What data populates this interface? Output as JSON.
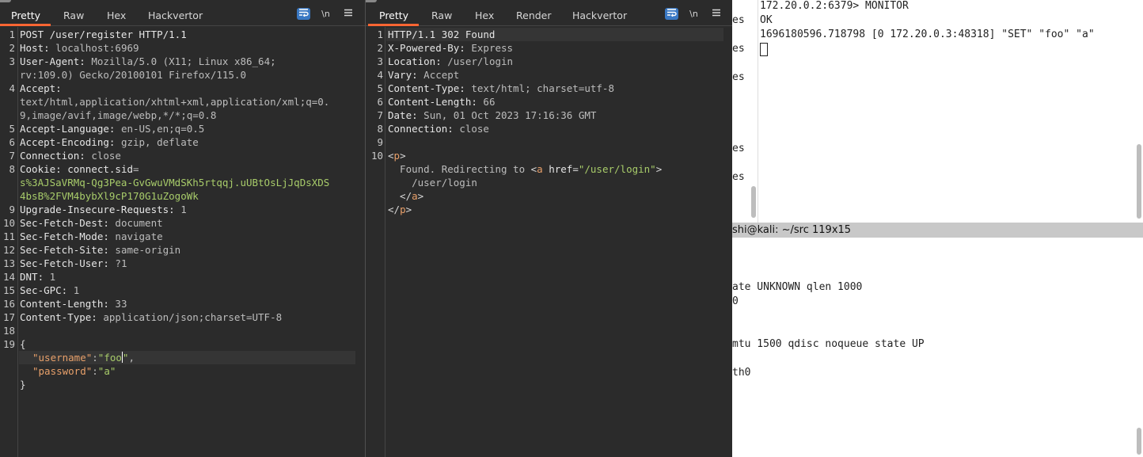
{
  "request_panel": {
    "tabs": [
      {
        "label": "Pretty",
        "active": true
      },
      {
        "label": "Raw",
        "active": false
      },
      {
        "label": "Hex",
        "active": false
      },
      {
        "label": "Hackvertor",
        "active": false
      }
    ],
    "tools": {
      "wrap_icon": "wrap-lines-icon",
      "newline_label": "\\n",
      "menu_icon": "hamburger-menu-icon"
    },
    "line_numbers": [
      "1",
      "2",
      "3",
      "4",
      "5",
      "6",
      "7",
      "8",
      "9",
      "10",
      "11",
      "12",
      "13",
      "14",
      "15",
      "16",
      "17",
      "18",
      "19"
    ],
    "lines": {
      "l1": "POST /user/register HTTP/1.1",
      "l2k": "Host:",
      "l2v": " localhost:6969",
      "l3k": "User-Agent:",
      "l3v": " Mozilla/5.0 (X11; Linux x86_64;",
      "l3c": "rv:109.0) Gecko/20100101 Firefox/115.0",
      "l4k": "Accept:",
      "l4c1": "text/html,application/xhtml+xml,application/xml;q=0.",
      "l4c2": "9,image/avif,image/webp,*/*;q=0.8",
      "l5k": "Accept-Language:",
      "l5v": " en-US,en;q=0.5",
      "l6k": "Accept-Encoding:",
      "l6v": " gzip, deflate",
      "l7k": "Connection:",
      "l7v": " close",
      "l8k": "Cookie:",
      "l8v": " connect.sid",
      "l8eq": "=",
      "l8c1": "s%3AJSaVRMq-Qg3Pea-GvGwuVMdSKh5rtqqj.uUBtOsLjJqDsXDS",
      "l8c2": "4bsB%2FVM4bybXl9cP170G1uZogoWk",
      "l9k": "Upgrade-Insecure-Requests:",
      "l9v": " 1",
      "l10k": "Sec-Fetch-Dest:",
      "l10v": " document",
      "l11k": "Sec-Fetch-Mode:",
      "l11v": " navigate",
      "l12k": "Sec-Fetch-Site:",
      "l12v": " same-origin",
      "l13k": "Sec-Fetch-User:",
      "l13v": " ?1",
      "l14k": "DNT:",
      "l14v": " 1",
      "l15k": "Sec-GPC:",
      "l15v": " 1",
      "l16k": "Content-Length:",
      "l16v": " 33",
      "l17k": "Content-Type:",
      "l17v": " application/json;charset=UTF-8",
      "l19": "{",
      "l20key": "\"username\"",
      "l20colon": ":",
      "l20val": "\"foo",
      "l20val2": "\"",
      "l20comma": ",",
      "l21key": "\"password\"",
      "l21colon": ":",
      "l21val": "\"a\"",
      "l22": "}"
    }
  },
  "response_panel": {
    "tabs": [
      {
        "label": "Pretty",
        "active": true
      },
      {
        "label": "Raw",
        "active": false
      },
      {
        "label": "Hex",
        "active": false
      },
      {
        "label": "Render",
        "active": false
      },
      {
        "label": "Hackvertor",
        "active": false
      }
    ],
    "tools": {
      "wrap_icon": "wrap-lines-icon",
      "newline_label": "\\n",
      "menu_icon": "hamburger-menu-icon"
    },
    "line_numbers": [
      "1",
      "2",
      "3",
      "4",
      "5",
      "6",
      "7",
      "8",
      "9",
      "10"
    ],
    "lines": {
      "l1": "HTTP/1.1 302 Found",
      "l2k": "X-Powered-By:",
      "l2v": " Express",
      "l3k": "Location:",
      "l3v": " /user/login",
      "l4k": "Vary:",
      "l4v": " Accept",
      "l5k": "Content-Type:",
      "l5v": " text/html; charset=utf-8",
      "l6k": "Content-Length:",
      "l6v": " 66",
      "l7k": "Date:",
      "l7v": " Sun, 01 Oct 2023 17:16:36 GMT",
      "l8k": "Connection:",
      "l8v": " close",
      "l10a": "<",
      "l10tag": "p",
      "l10b": ">",
      "l11text": "  Found. Redirecting to ",
      "l11lt": "<",
      "l11tag": "a",
      "l11attr": " href",
      "l11eq": "=",
      "l11val": "\"/user/login\"",
      "l11gt": ">",
      "l12": "    /user/login",
      "l13a": "  </",
      "l13tag": "a",
      "l13b": ">",
      "l14a": "</",
      "l14tag": "p",
      "l14b": ">"
    }
  },
  "terminal": {
    "top_lines": [
      "172.20.0.2:6379> MONITOR",
      "OK",
      "1696180596.718798 [0 172.20.0.3:48318] \"SET\" \"foo\" \"a\""
    ],
    "left_fragments": [
      "es",
      "es",
      "es",
      "es",
      "es"
    ],
    "title": "shi@kali: ~/src 119x15",
    "bottom_lines": [
      "ate UNKNOWN qlen 1000",
      "0",
      "mtu 1500 qdisc noqueue state UP",
      "th0"
    ]
  },
  "colors": {
    "accent_tab": "#ff6633",
    "wrap_button": "#3a78c3",
    "string_green": "#a8cc6a",
    "tag_orange": "#e8a06a"
  }
}
